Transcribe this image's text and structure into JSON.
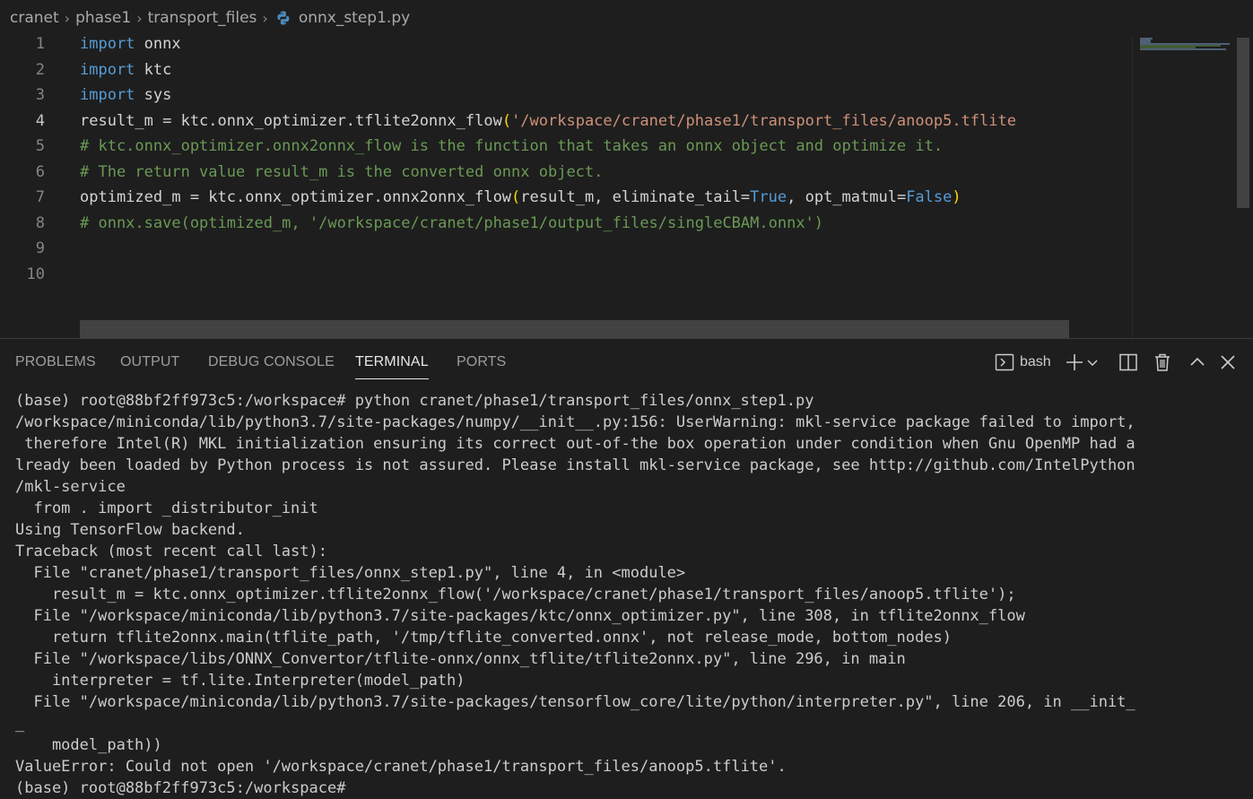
{
  "breadcrumb": {
    "items": [
      "cranet",
      "phase1",
      "transport_files",
      "onnx_step1.py"
    ]
  },
  "editor": {
    "active_line": 4,
    "lines": [
      {
        "num": "1",
        "tokens": [
          {
            "t": "import",
            "c": "kw"
          },
          {
            "t": " onnx",
            "c": "id"
          }
        ]
      },
      {
        "num": "2",
        "tokens": [
          {
            "t": "import",
            "c": "kw"
          },
          {
            "t": " ktc",
            "c": "id"
          }
        ]
      },
      {
        "num": "3",
        "tokens": [
          {
            "t": "import",
            "c": "kw"
          },
          {
            "t": " sys",
            "c": "id"
          }
        ]
      },
      {
        "num": "4",
        "tokens": [
          {
            "t": "result_m = ktc.onnx_optimizer.tflite2onnx_flow",
            "c": "id"
          },
          {
            "t": "(",
            "c": "paren"
          },
          {
            "t": "'/workspace/cranet/phase1/transport_files/anoop5.tflite",
            "c": "str"
          }
        ]
      },
      {
        "num": "5",
        "tokens": [
          {
            "t": "# ktc.onnx_optimizer.onnx2onnx_flow is the function that takes an onnx object and optimize it.",
            "c": "cmt"
          }
        ]
      },
      {
        "num": "6",
        "tokens": [
          {
            "t": "# The return value result_m is the converted onnx object.",
            "c": "cmt"
          }
        ]
      },
      {
        "num": "7",
        "tokens": [
          {
            "t": "optimized_m = ktc.onnx_optimizer.onnx2onnx_flow",
            "c": "id"
          },
          {
            "t": "(",
            "c": "paren"
          },
          {
            "t": "result_m, eliminate_tail=",
            "c": "id"
          },
          {
            "t": "True",
            "c": "kw"
          },
          {
            "t": ", opt_matmul=",
            "c": "id"
          },
          {
            "t": "False",
            "c": "kw"
          },
          {
            "t": ")",
            "c": "paren"
          }
        ]
      },
      {
        "num": "8",
        "tokens": [
          {
            "t": "# onnx.save(optimized_m, '/workspace/cranet/phase1/output_files/singleCBAM.onnx')",
            "c": "cmt"
          }
        ]
      },
      {
        "num": "9",
        "tokens": []
      },
      {
        "num": "10",
        "tokens": []
      }
    ]
  },
  "panel": {
    "tabs": [
      {
        "label": "PROBLEMS",
        "active": false
      },
      {
        "label": "OUTPUT",
        "active": false
      },
      {
        "label": "DEBUG CONSOLE",
        "active": false
      },
      {
        "label": "TERMINAL",
        "active": true
      },
      {
        "label": "PORTS",
        "active": false
      }
    ],
    "shell_label": "bash"
  },
  "terminal": {
    "lines": [
      "(base) root@88bf2ff973c5:/workspace# python cranet/phase1/transport_files/onnx_step1.py",
      "/workspace/miniconda/lib/python3.7/site-packages/numpy/__init__.py:156: UserWarning: mkl-service package failed to import,",
      " therefore Intel(R) MKL initialization ensuring its correct out-of-the box operation under condition when Gnu OpenMP had a",
      "lready been loaded by Python process is not assured. Please install mkl-service package, see http://github.com/IntelPython",
      "/mkl-service",
      "  from . import _distributor_init",
      "Using TensorFlow backend.",
      "Traceback (most recent call last):",
      "  File \"cranet/phase1/transport_files/onnx_step1.py\", line 4, in <module>",
      "    result_m = ktc.onnx_optimizer.tflite2onnx_flow('/workspace/cranet/phase1/transport_files/anoop5.tflite');",
      "  File \"/workspace/miniconda/lib/python3.7/site-packages/ktc/onnx_optimizer.py\", line 308, in tflite2onnx_flow",
      "    return tflite2onnx.main(tflite_path, '/tmp/tflite_converted.onnx', not release_mode, bottom_nodes)",
      "  File \"/workspace/libs/ONNX_Convertor/tflite-onnx/onnx_tflite/tflite2onnx.py\", line 296, in main",
      "    interpreter = tf.lite.Interpreter(model_path)",
      "  File \"/workspace/miniconda/lib/python3.7/site-packages/tensorflow_core/lite/python/interpreter.py\", line 206, in __init_",
      "_",
      "    model_path))",
      "ValueError: Could not open '/workspace/cranet/phase1/transport_files/anoop5.tflite'.",
      "(base) root@88bf2ff973c5:/workspace# "
    ]
  }
}
